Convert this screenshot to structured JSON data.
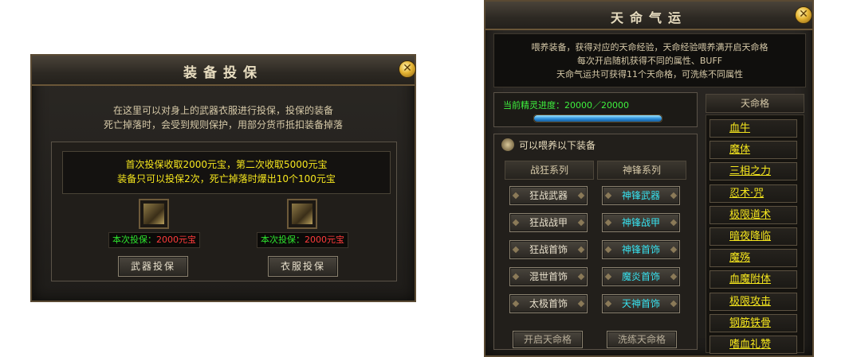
{
  "insurance": {
    "title": "装备投保",
    "intro_line1": "在这里可以对身上的武器衣服进行投保，投保的装备",
    "intro_line2": "死亡掉落时，会受到规则保护，用部分货币抵扣装备掉落",
    "rule_line1": "首次投保收取2000元宝，第二次收取5000元宝",
    "rule_line2": "装备只可以投保2次，死亡掉落时爆出10个100元宝",
    "weapon": {
      "price_label": "本次投保：",
      "price_value": "2000元宝",
      "button": "武器投保"
    },
    "armor": {
      "price_label": "本次投保：",
      "price_value": "2000元宝",
      "button": "衣服投保"
    },
    "close": "✕"
  },
  "fate": {
    "title": "天命气运",
    "info_line1": "喂养装备，获得对应的天命经验，天命经验喂养满开启天命格",
    "info_line2": "每次开启随机获得不同的属性、BUFF",
    "info_line3": "天命气运共可获得11个天命格，可洗练不同属性",
    "progress_label": "当前精灵进度：20000／20000",
    "progress_fraction": 1.0,
    "feed_label": "可以喂养以下装备",
    "col_left": "战狂系列",
    "col_right": "神锋系列",
    "left_items": [
      "狂战武器",
      "狂战战甲",
      "狂战首饰",
      "混世首饰",
      "太极首饰"
    ],
    "right_items": [
      "神锋武器",
      "神锋战甲",
      "神锋首饰",
      "魔炎首饰",
      "天神首饰"
    ],
    "fate_grid_title": "天命格",
    "fate_grid": [
      "血牛",
      "魔体",
      "三相之力",
      "忍术·咒",
      "极限道术",
      "暗夜降临",
      "魔殇",
      "血魔附体",
      "极限攻击",
      "钢筋铁骨",
      "嗜血礼赞"
    ],
    "btn_open": "开启天命格",
    "btn_refine": "洗练天命格",
    "close": "✕"
  },
  "colors": {
    "gold_text": "#f6e71e",
    "cyan_text": "#37e3f0",
    "green_text": "#2ee52e",
    "red_text": "#ff3b3b"
  }
}
